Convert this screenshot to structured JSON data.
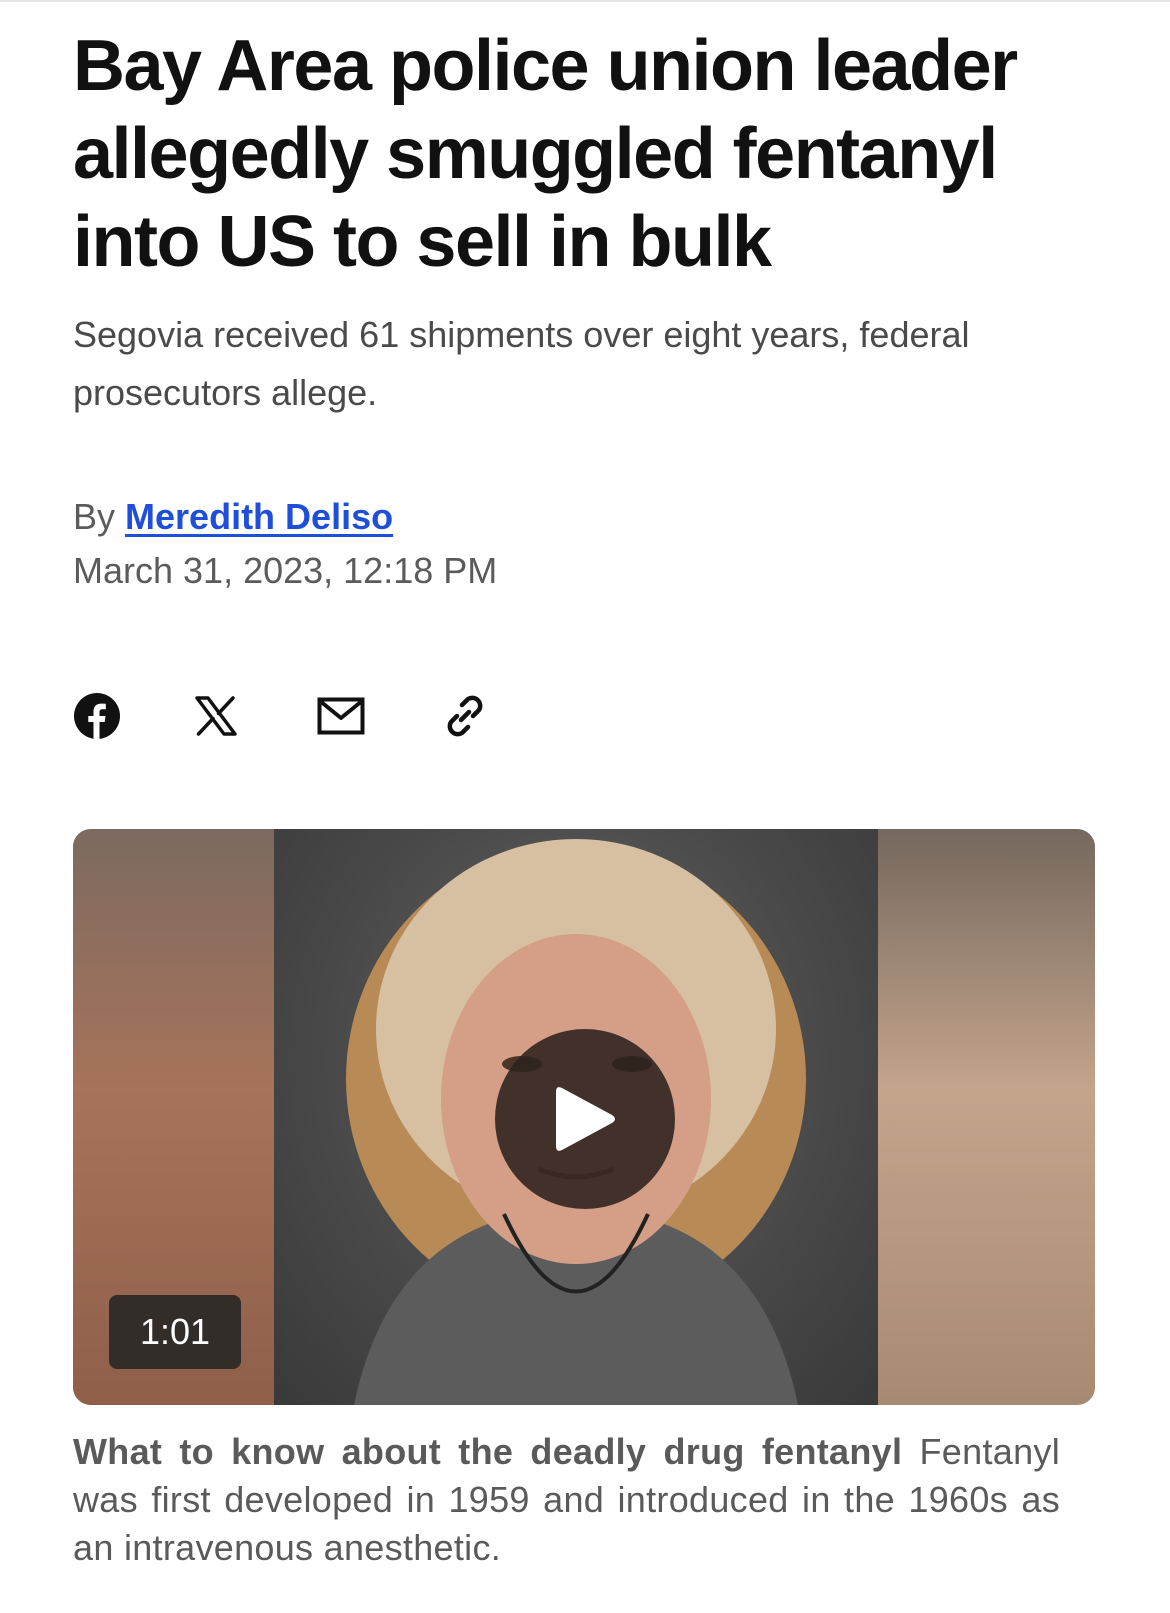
{
  "article": {
    "headline": "Bay Area police union leader allegedly smuggled fentanyl into US to sell in bulk",
    "dek": "Segovia received 61 shipments over eight years, federal prosecutors allege.",
    "byline_prefix": "By",
    "author": "Meredith Deliso",
    "date": "March 31, 2023, 12:18 PM"
  },
  "share": {
    "icons": [
      "facebook-icon",
      "x-icon",
      "mail-icon",
      "link-icon"
    ]
  },
  "video": {
    "duration": "1:01",
    "caption_title": "What to know about the deadly drug fentanyl",
    "caption_text": "Fentanyl was first developed in 1959 and introduced in the 1960s as an intravenous anesthetic."
  },
  "colors": {
    "link": "#1f4fd8",
    "text": "#111111",
    "muted": "#5b5b5b"
  }
}
